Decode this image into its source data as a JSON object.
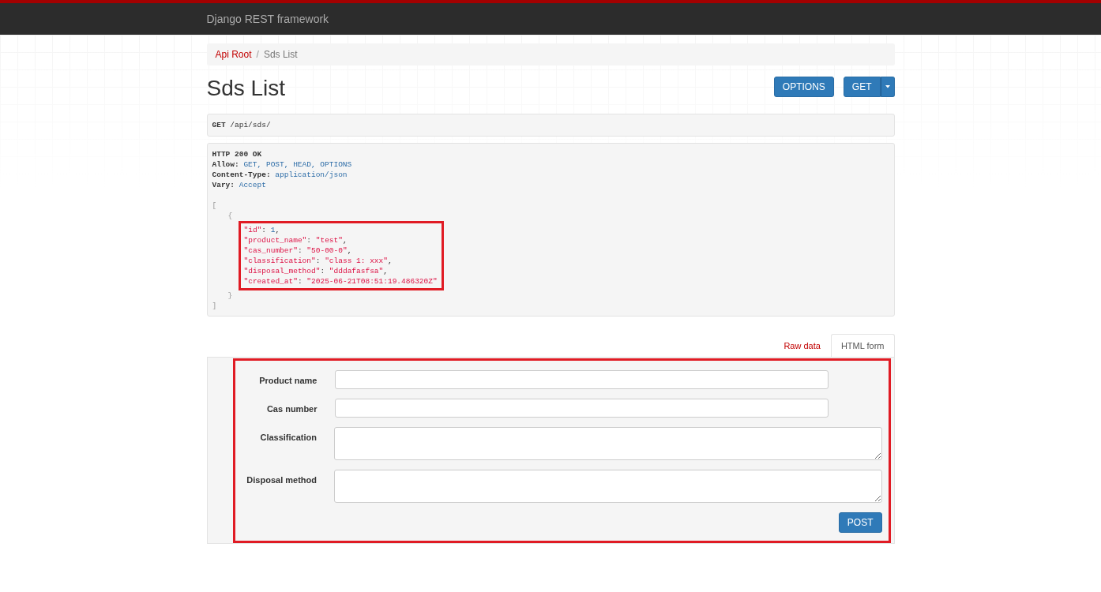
{
  "navbar": {
    "brand": "Django REST framework"
  },
  "breadcrumbs": [
    {
      "label": "Api Root",
      "selected": false
    },
    {
      "label": "/",
      "kind": "separator"
    },
    {
      "label": "Sds List",
      "selected": true
    }
  ],
  "title": "Sds List",
  "buttons": [
    {
      "label": "OPTIONS",
      "kind": "plain"
    },
    {
      "label": "GET",
      "kind": "split"
    }
  ],
  "request": {
    "method": "GET",
    "path": "/api/sds/"
  },
  "response": {
    "status": "HTTP 200 OK",
    "headers": [
      {
        "name": "Allow:",
        "value": "GET, POST, HEAD, OPTIONS"
      },
      {
        "name": "Content-Type:",
        "value": "application/json"
      },
      {
        "name": "Vary:",
        "value": "Accept"
      }
    ],
    "body": {
      "open": "[",
      "close": "]",
      "children": [
        {
          "open": "{",
          "close": "}",
          "highlighted": true,
          "fields": [
            {
              "key": "\"id\"",
              "sep": ": ",
              "value": "1",
              "kind": "number",
              "end": ","
            },
            {
              "key": "\"product_name\"",
              "sep": ": ",
              "value": "\"test\"",
              "kind": "string",
              "end": ","
            },
            {
              "key": "\"cas_number\"",
              "sep": ": ",
              "value": "\"50-00-0\"",
              "kind": "string",
              "end": ","
            },
            {
              "key": "\"classification\"",
              "sep": ": ",
              "value": "\"class 1: xxx\"",
              "kind": "string",
              "end": ","
            },
            {
              "key": "\"disposal_method\"",
              "sep": ": ",
              "value": "\"dddafasfsa\"",
              "kind": "string",
              "end": ","
            },
            {
              "key": "\"created_at\"",
              "sep": ": ",
              "value": "\"2025-06-21T08:51:19.486320Z\"",
              "kind": "string"
            }
          ]
        }
      ]
    }
  },
  "tabs": [
    {
      "label": "Raw data",
      "selected": false
    },
    {
      "label": "HTML form",
      "selected": true
    }
  ],
  "form": {
    "highlighted": true,
    "fields": [
      {
        "label": "Product name",
        "kind": "input"
      },
      {
        "label": "Cas number",
        "kind": "input"
      },
      {
        "label": "Classification",
        "kind": "textarea"
      },
      {
        "label": "Disposal method",
        "kind": "textarea"
      }
    ],
    "submit": "POST"
  }
}
